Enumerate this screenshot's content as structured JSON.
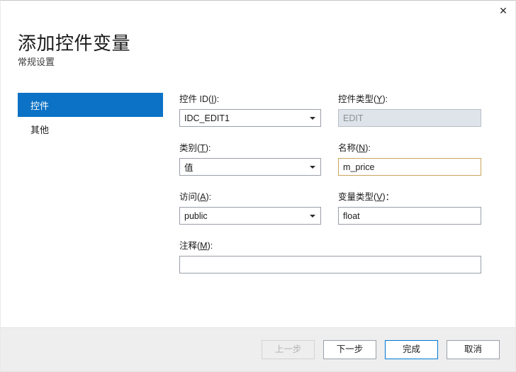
{
  "window": {
    "close_label": "✕"
  },
  "header": {
    "title": "添加控件变量",
    "subtitle": "常规设置"
  },
  "sidebar": {
    "items": [
      {
        "label": "控件",
        "selected": true
      },
      {
        "label": "其他",
        "selected": false
      }
    ]
  },
  "form": {
    "control_id": {
      "label_prefix": "控件 ID(",
      "accel": "I",
      "label_suffix": "):",
      "value": "IDC_EDIT1"
    },
    "control_type": {
      "label_prefix": "控件类型(",
      "accel": "Y",
      "label_suffix": "):",
      "value": "EDIT"
    },
    "category": {
      "label_prefix": "类别(",
      "accel": "T",
      "label_suffix": "):",
      "value": "值"
    },
    "name": {
      "label_prefix": "名称(",
      "accel": "N",
      "label_suffix": "):",
      "value": "m_price"
    },
    "access": {
      "label_prefix": "访问(",
      "accel": "A",
      "label_suffix": "):",
      "value": "public"
    },
    "variable_type": {
      "label_prefix": "变量类型(",
      "accel": "V",
      "label_suffix": ")：",
      "value": "float"
    },
    "comment": {
      "label_prefix": "注释(",
      "accel": "M",
      "label_suffix": "):",
      "value": "",
      "placeholder": ""
    }
  },
  "footer": {
    "back_label": "上一步",
    "next_label": "下一步",
    "finish_label": "完成",
    "cancel_label": "取消"
  },
  "colors": {
    "accent": "#0c72c6",
    "default_button_border": "#0078d7",
    "highlight_field_border": "#c8a45a",
    "footer_background": "#eeeeee",
    "disabled_field_background": "#dfe3ea"
  }
}
